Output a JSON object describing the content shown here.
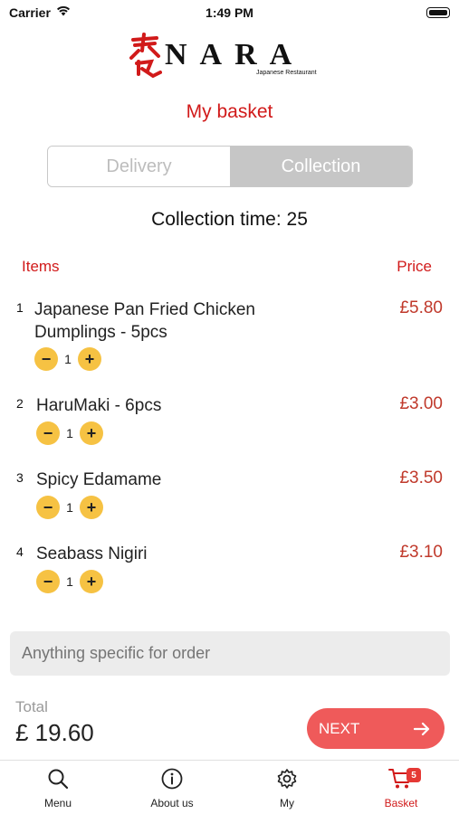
{
  "status_bar": {
    "carrier": "Carrier",
    "time": "1:49 PM"
  },
  "brand": {
    "name": "NARA",
    "subtitle": "Japanese Restaurant",
    "accent": "#d11a1a"
  },
  "page_title": "My basket",
  "mode_toggle": {
    "options": [
      "Delivery",
      "Collection"
    ],
    "selected": "Collection"
  },
  "collection_time": "Collection time: 25",
  "list_header": {
    "items": "Items",
    "price": "Price"
  },
  "items": [
    {
      "index": "1",
      "name": "Japanese Pan Fried Chicken Dumplings - 5pcs",
      "price": "£5.80",
      "qty": "1"
    },
    {
      "index": "2",
      "name": "HaruMaki  - 6pcs",
      "price": "£3.00",
      "qty": "1"
    },
    {
      "index": "3",
      "name": "Spicy Edamame",
      "price": "£3.50",
      "qty": "1"
    },
    {
      "index": "4",
      "name": "Seabass Nigiri",
      "price": "£3.10",
      "qty": "1"
    }
  ],
  "order_note": {
    "placeholder": "Anything specific for order"
  },
  "total": {
    "label": "Total",
    "value": "£ 19.60"
  },
  "next_button": {
    "label": "NEXT"
  },
  "tab_bar": {
    "tabs": [
      {
        "label": "Menu",
        "icon": "search-icon"
      },
      {
        "label": "About us",
        "icon": "info-icon"
      },
      {
        "label": "My",
        "icon": "gear-icon"
      },
      {
        "label": "Basket",
        "icon": "cart-icon",
        "badge": "5"
      }
    ],
    "active": "Basket"
  }
}
